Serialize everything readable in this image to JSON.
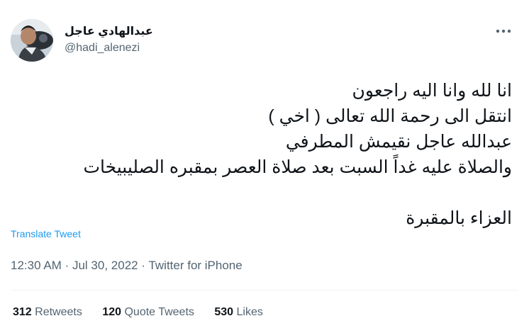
{
  "author": {
    "display_name": "عبدالهادي عاجل",
    "handle": "@hadi_alenezi",
    "avatar": "user-avatar-photo"
  },
  "menu": {
    "icon": "more-horizontal-icon"
  },
  "tweet": {
    "lines": [
      "انا لله وانا اليه راجعون",
      "انتقل الى رحمة الله تعالى ( اخي )",
      "عبدالله عاجل نقيمش المطرفي",
      "والصلاة عليه غداً السبت بعد صلاة العصر بمقبره الصليبيخات",
      "العزاء بالمقبرة"
    ],
    "translate_label": "Translate Tweet"
  },
  "meta": {
    "time": "12:30 AM",
    "separator": "·",
    "date": "Jul 30, 2022",
    "source": "Twitter for iPhone"
  },
  "stats": {
    "retweets": {
      "count": "312",
      "label": "Retweets"
    },
    "quotes": {
      "count": "120",
      "label": "Quote Tweets"
    },
    "likes": {
      "count": "530",
      "label": "Likes"
    }
  },
  "colors": {
    "link": "#1d9bf0",
    "secondary_text": "#536471",
    "primary_text": "#0f1419",
    "divider": "#eff3f4"
  }
}
